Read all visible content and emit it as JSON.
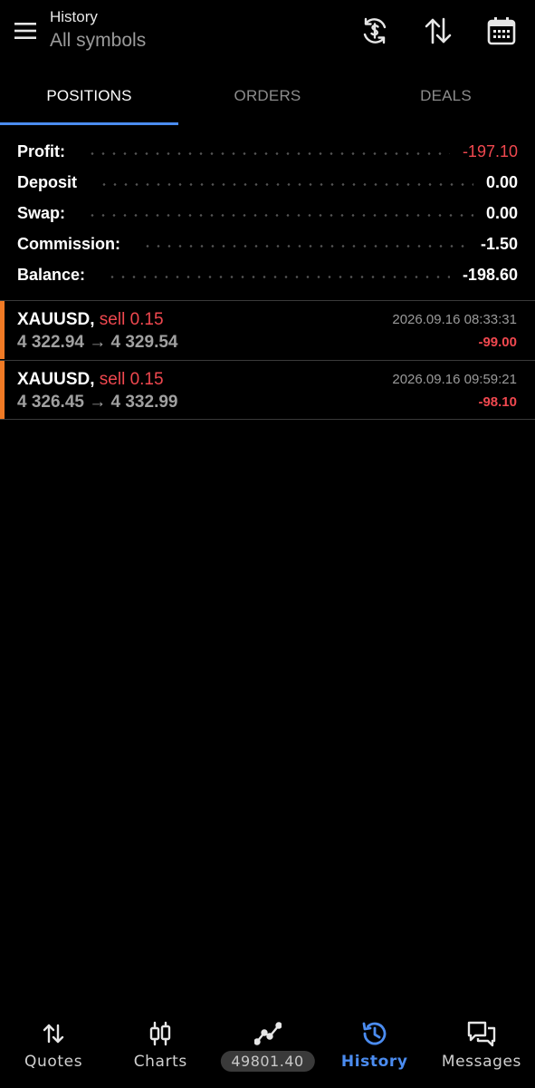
{
  "header": {
    "title": "History",
    "subtitle": "All symbols"
  },
  "tabs": [
    {
      "label": "POSITIONS",
      "active": true
    },
    {
      "label": "ORDERS",
      "active": false
    },
    {
      "label": "DEALS",
      "active": false
    }
  ],
  "summary": {
    "profit_label": "Profit:",
    "profit_value": "-197.10",
    "deposit_label": "Deposit",
    "deposit_value": "0.00",
    "swap_label": "Swap:",
    "swap_value": "0.00",
    "commission_label": "Commission:",
    "commission_value": "-1.50",
    "balance_label": "Balance:",
    "balance_value": "-198.60"
  },
  "positions": [
    {
      "symbol": "XAUUSD,",
      "type": "sell 0.15",
      "price": "4 322.94 → 4 329.54",
      "time": "2026.09.16 08:33:31",
      "profit": "-99.00"
    },
    {
      "symbol": "XAUUSD,",
      "type": "sell 0.15",
      "price": "4 326.45 → 4 332.99",
      "time": "2026.09.16 09:59:21",
      "profit": "-98.10"
    }
  ],
  "nav": {
    "quotes": "Quotes",
    "charts": "Charts",
    "trade_value": "49801.40",
    "history": "History",
    "messages": "Messages"
  },
  "colors": {
    "accent": "#4b8cf0",
    "loss": "#f0484f",
    "sell_bar": "#f07a25"
  },
  "icons": [
    "menu-icon",
    "currency-exchange-icon",
    "sort-icon",
    "calendar-icon",
    "quotes-icon",
    "charts-icon",
    "trade-icon",
    "history-icon",
    "messages-icon"
  ]
}
